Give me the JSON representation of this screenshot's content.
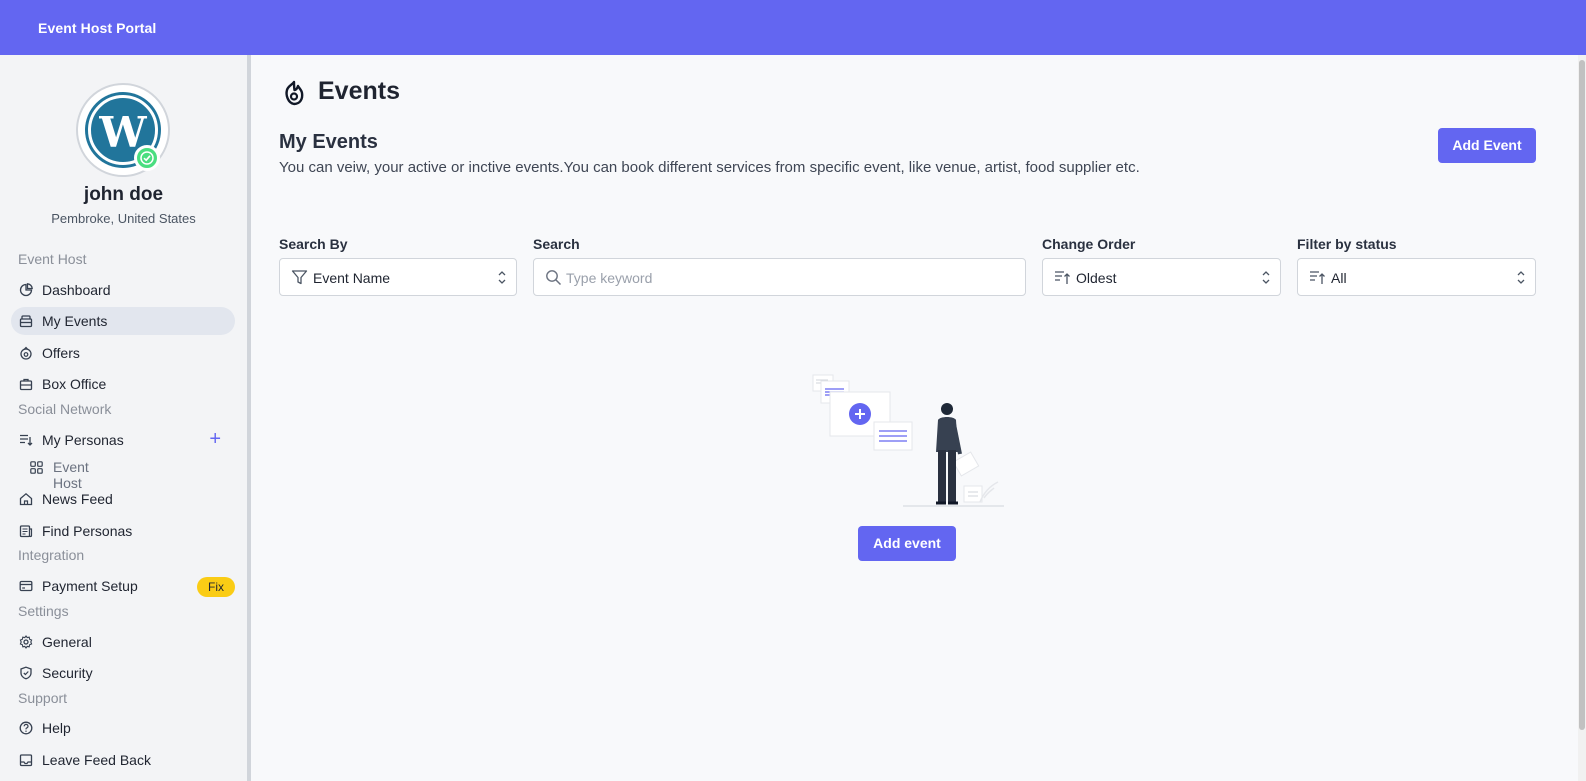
{
  "app": {
    "title": "Event Host Portal",
    "accent": "#6366f1"
  },
  "profile": {
    "name": "john doe",
    "location": "Pembroke, United States",
    "avatar_icon": "wordpress-logo",
    "status_icon": "check-badge-icon"
  },
  "sidebar": {
    "sections": {
      "event_host": "Event Host",
      "social_network": "Social Network",
      "integration": "Integration",
      "settings": "Settings",
      "support": "Support"
    },
    "items": {
      "dashboard": "Dashboard",
      "my_events": "My Events",
      "offers": "Offers",
      "box_office": "Box Office",
      "my_personas": "My Personas",
      "persona_event_host": "Event Host",
      "news_feed": "News Feed",
      "find_personas": "Find Personas",
      "payment_setup": "Payment Setup",
      "payment_badge": "Fix",
      "general": "General",
      "security": "Security",
      "help": "Help",
      "leave_feedback": "Leave Feed Back"
    },
    "plus_symbol": "+"
  },
  "main": {
    "title": "Events",
    "subtitle": "My Events",
    "description": "You can veiw, your active or inctive events.You can book different services from specific event, like venue, artist, food supplier etc.",
    "add_event_label": "Add Event",
    "empty_add_label": "Add event"
  },
  "filters": {
    "search_by": {
      "label": "Search By",
      "value": "Event Name"
    },
    "search": {
      "label": "Search",
      "placeholder": "Type keyword"
    },
    "change_order": {
      "label": "Change Order",
      "value": "Oldest"
    },
    "status": {
      "label": "Filter by status",
      "value": "All"
    }
  }
}
